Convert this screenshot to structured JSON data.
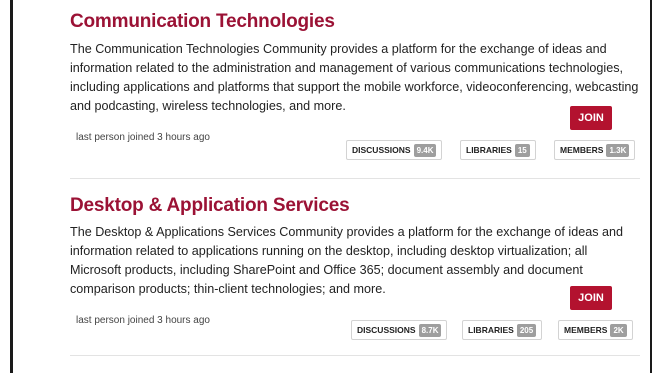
{
  "communities": [
    {
      "title": "Communication Technologies",
      "description": "The Communication Technologies Community provides a platform for the exchange of ideas and information related to the administration and management of various communications technologies, including applications and platforms that support the mobile workforce, videoconferencing, webcasting and podcasting, wireless technologies, and more.",
      "join_label": "JOIN",
      "last_joined": "last person joined 3 hours ago",
      "stats": {
        "discussions": {
          "label": "DISCUSSIONS",
          "count": "9.4K"
        },
        "libraries": {
          "label": "LIBRARIES",
          "count": "15"
        },
        "members": {
          "label": "MEMBERS",
          "count": "1.3K"
        }
      }
    },
    {
      "title": "Desktop & Application Services",
      "description": "The Desktop & Applications Services Community provides a platform for the exchange of ideas and information related to applications running on the desktop, including desktop virtualization; all Microsoft products, including SharePoint and Office 365; document assembly and document comparison products; thin-client technologies; and more.",
      "join_label": "JOIN",
      "last_joined": "last person joined 3 hours ago",
      "stats": {
        "discussions": {
          "label": "DISCUSSIONS",
          "count": "8.7K"
        },
        "libraries": {
          "label": "LIBRARIES",
          "count": "205"
        },
        "members": {
          "label": "MEMBERS",
          "count": "2K"
        }
      }
    }
  ],
  "colors": {
    "title": "#9b1235",
    "join_button": "#b3122f",
    "count_badge": "#9e9e9e"
  }
}
